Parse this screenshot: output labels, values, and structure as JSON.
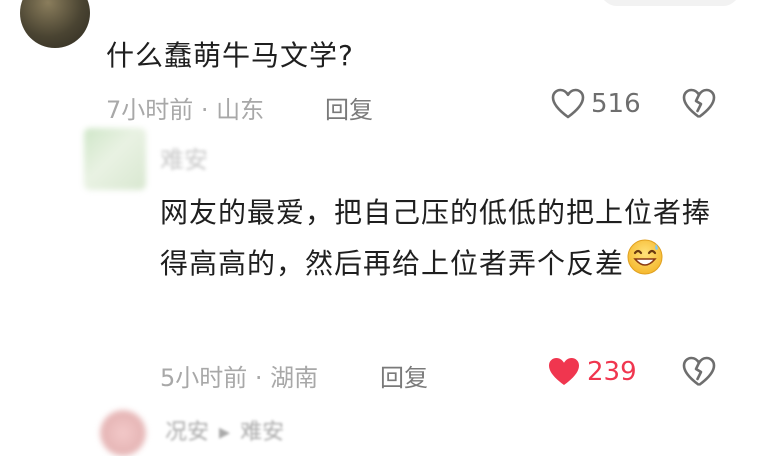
{
  "comments": [
    {
      "text": "什么蠢萌牛马文学?",
      "time": "7小时前",
      "location": "山东",
      "reply_label": "回复",
      "likes": "516",
      "liked": false
    }
  ],
  "reply": {
    "username": "难安",
    "text": "网友的最爱，把自己压的低低的把上位者捧得高高的，然后再给上位者弄个反差",
    "time": "5小时前",
    "location": "湖南",
    "reply_label": "回复",
    "likes": "239",
    "liked": true
  },
  "next_reply": {
    "user_a": "况安",
    "user_b": "难安"
  },
  "icons": {
    "like_icon": "heart-outline-icon",
    "liked_icon": "heart-filled-icon",
    "dislike_icon": "broken-heart-icon",
    "arrow_icon": "triangle-right-icon",
    "emoji": "grin-sweat-emoji"
  },
  "colors": {
    "like_active": "#f0364f",
    "meta_text": "#a8a8a8",
    "body_text": "#1f1f1f"
  }
}
